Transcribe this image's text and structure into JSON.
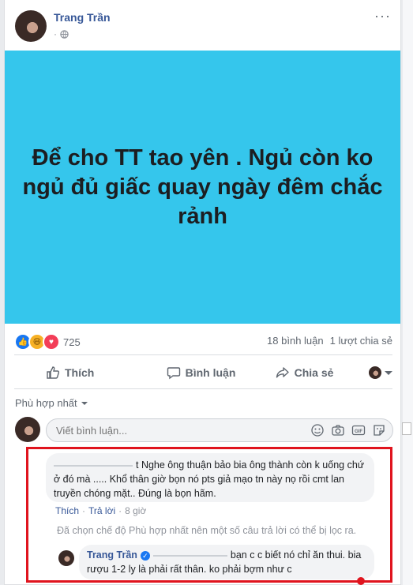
{
  "post": {
    "author": "Trang Trần",
    "meta_time": "·",
    "more_label": "···",
    "image_text": "Để cho TT tao yên . Ngủ còn ko ngủ đủ giấc quay ngày đêm chắc rảnh",
    "image_bg": "#35c6ec"
  },
  "stats": {
    "reaction_count": "725",
    "comments": "18 bình luận",
    "shares": "1 lượt chia sẻ",
    "reaction_types": [
      "like-icon",
      "haha-icon",
      "love-icon"
    ]
  },
  "actions": {
    "like": "Thích",
    "comment": "Bình luận",
    "share": "Chia sẻ"
  },
  "comments": {
    "sort_label": "Phù hợp nhất",
    "composer_placeholder": "Viết bình luận...",
    "first_comment_text": "t Nghe ông thuận bảo bia ông thành còn k uống chứ ở đó mà ..... Khổ thân giờ bọn nó pts giả mạo tn này nọ rồi cmt lan truyền chóng mặt.. Đúng là bọn hãm.",
    "first_comment_like": "Thích",
    "first_comment_reply": "Trả lời",
    "first_comment_time": "8 giờ",
    "filter_note": "Đã chọn chế độ Phù hợp nhất nên một số câu trả lời có thể bị lọc ra.",
    "reply_author": "Trang Trần",
    "reply_text": "bạn c c biết nó chỉ ăn thui. bia rượu 1-2 ly là phải rất thân. ko phải bợm như c"
  },
  "colors": {
    "link_blue": "#385898",
    "highlight_red": "#e0141e",
    "page_bg": "#e9ebee"
  }
}
